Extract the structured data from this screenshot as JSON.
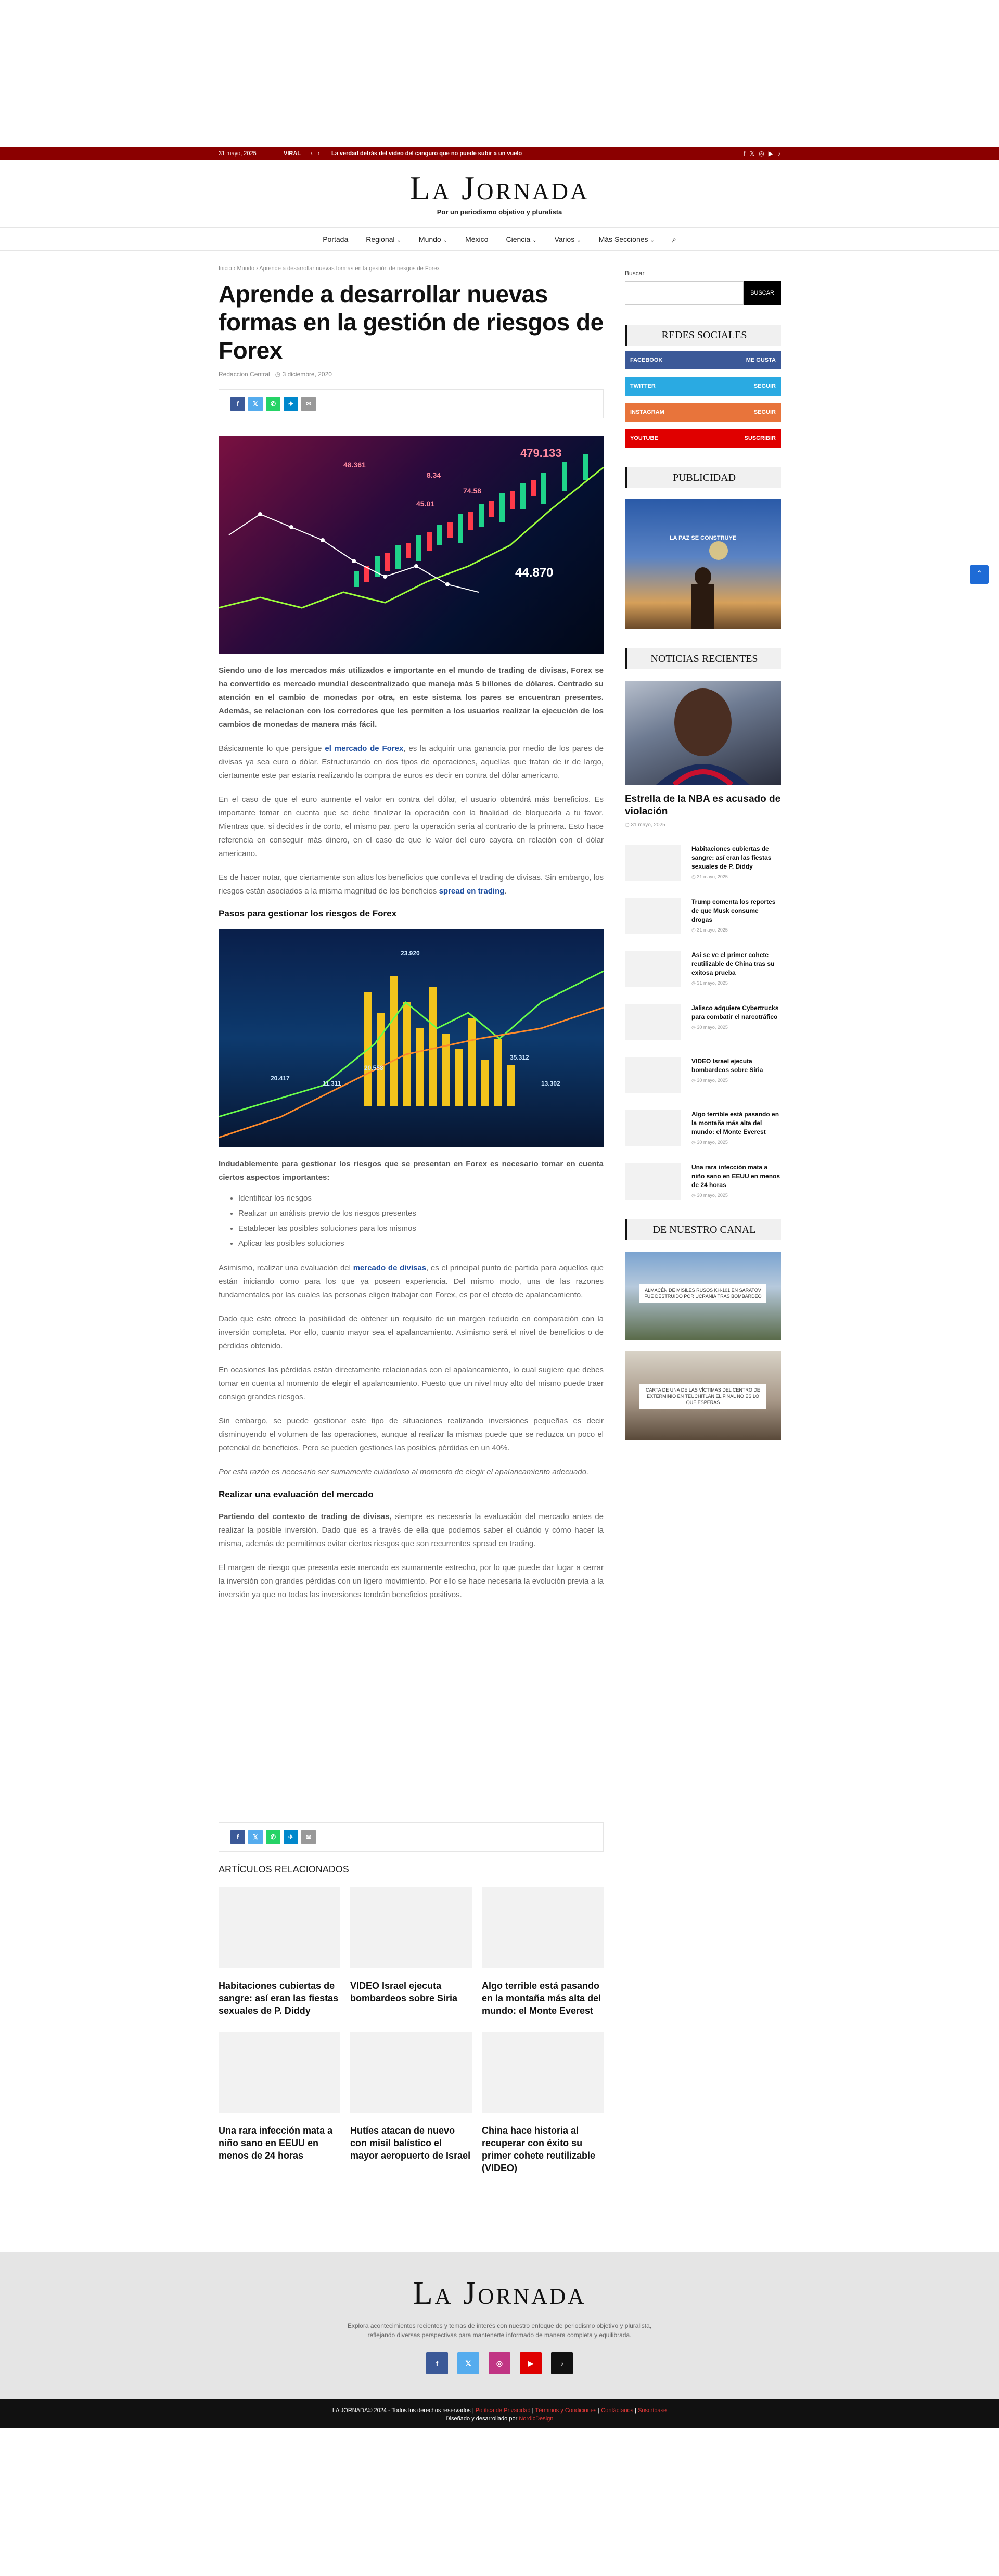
{
  "topbar": {
    "date": "31 mayo, 2025",
    "viral_label": "VIRAL",
    "prev_arrow": "‹",
    "next_arrow": "›",
    "ticker_text": "La verdad detrás del video del canguro que no puede subir a un vuelo",
    "social_icons": [
      "facebook-icon",
      "x-icon",
      "instagram-icon",
      "youtube-icon",
      "tiktok-icon"
    ]
  },
  "header": {
    "logo": "La Jornada",
    "tagline": "Por un periodismo objetivo y pluralista"
  },
  "nav": {
    "items": [
      {
        "label": "Portada",
        "dropdown": false
      },
      {
        "label": "Regional",
        "dropdown": true
      },
      {
        "label": "Mundo",
        "dropdown": true
      },
      {
        "label": "México",
        "dropdown": false
      },
      {
        "label": "Ciencia",
        "dropdown": true
      },
      {
        "label": "Varios",
        "dropdown": true
      },
      {
        "label": "Más Secciones",
        "dropdown": true
      }
    ],
    "search_icon": "search-icon"
  },
  "article": {
    "breadcrumb": [
      "Inicio",
      "Mundo",
      "Aprende a desarrollar nuevas formas en la gestión de riesgos de Forex"
    ],
    "title": "Aprende a desarrollar nuevas formas en la gestión de riesgos de Forex",
    "author": "Redaccion Central",
    "date": "3 diciembre, 2020",
    "share_buttons": [
      "f",
      "𝕏",
      "✆",
      "✈",
      "✉"
    ],
    "intro": "Siendo uno de los mercados más utilizados e importante en el mundo de trading de divisas, Forex se ha convertido es mercado mundial descentralizado que maneja más 5 billones de dólares. Centrado su atención en el cambio de monedas por otra, en este sistema los pares se encuentran presentes. Además, se relacionan con los corredores que les permiten a los usuarios realizar la ejecución de los cambios de monedas de manera más fácil.",
    "p1_before": "Básicamente lo que persigue ",
    "p1_link": "el mercado de Forex",
    "p1_after": ", es la adquirir una ganancia por medio de los pares de divisas ya sea euro o dólar. Estructurando en dos tipos de operaciones, aquellas que tratan de ir de largo, ciertamente este par estaría realizando la compra de euros es decir en contra del dólar americano.",
    "p2": "En el caso de que el euro aumente el valor en contra del dólar, el usuario obtendrá más beneficios. Es importante tomar en cuenta que se debe finalizar la operación con la finalidad de bloquearla a tu favor. Mientras que, si decides ir de corto, el mismo par, pero la operación sería al contrario de la primera. Esto hace referencia en conseguir más dinero, en el caso de que le valor del euro cayera en relación con el dólar americano.",
    "p3_before": "Es de hacer notar, que ciertamente son altos los beneficios que conlleva el trading de divisas. Sin embargo, los riesgos están asociados a la misma magnitud de los beneficios ",
    "p3_link": "spread en trading",
    "p3_after": ".",
    "h_pasos": "Pasos para gestionar los riesgos de Forex",
    "p4": "Indudablemente para gestionar los riesgos que se presentan en Forex es necesario tomar en cuenta ciertos aspectos importantes:",
    "bullets": [
      "Identificar los riesgos",
      "Realizar un análisis previo de los riesgos presentes",
      "Establecer las posibles soluciones para los mismos",
      "Aplicar las posibles soluciones"
    ],
    "p5_before": "Asimismo, realizar una evaluación del ",
    "p5_link": "mercado de divisas",
    "p5_after": ", es el principal punto de partida para aquellos que están iniciando como para los que ya poseen experiencia. Del mismo modo, una de las razones fundamentales por las cuales las personas eligen trabajar con Forex, es por el efecto de apalancamiento.",
    "p6": "Dado que este ofrece la posibilidad de obtener un requisito de un margen reducido en comparación con la inversión completa. Por ello, cuanto mayor sea el apalancamiento. Asimismo será el nivel de beneficios o de pérdidas obtenido.",
    "p7": "En ocasiones las pérdidas están directamente relacionadas con el apalancamiento, lo cual sugiere que debes tomar en cuenta al momento de elegir el apalancamiento. Puesto que un nivel muy alto del mismo puede traer consigo grandes riesgos.",
    "p8": "Sin embargo, se puede gestionar este tipo de situaciones realizando inversiones pequeñas es decir disminuyendo el volumen de las operaciones, aunque al realizar la mismas puede que se reduzca un poco el potencial de beneficios. Pero se pueden gestiones las posibles pérdidas en un 40%.",
    "p9": "Por esta razón es necesario ser sumamente cuidadoso al momento de elegir el apalancamiento adecuado.",
    "h_realizar": "Realizar una evaluación del mercado",
    "p10_bold": "Partiendo del contexto de trading de divisas,",
    "p10_rest": " siempre es necesaria la evaluación del mercado antes de realizar la posible inversión. Dado que es a través de ella que podemos saber el cuándo y cómo hacer la misma, además de permitirnos evitar ciertos riesgos que son recurrentes spread en trading.",
    "p11": "El margen de riesgo que presenta este mercado es sumamente estrecho, por lo que puede dar lugar a cerrar la inversión con grandes pérdidas con un ligero movimiento. Por ello se hace necesaria la evolución previa a la inversión ya que no todas las inversiones tendrán beneficios positivos."
  },
  "hero_chart_labels": [
    "48.361",
    "479.133",
    "44.870",
    "8.34",
    "74.58",
    "45.01"
  ],
  "img2_labels": [
    "23.920",
    "20.558",
    "35.312",
    "13.302",
    "20.417",
    "11.311"
  ],
  "related": {
    "title": "ARTÍCULOS RELACIONADOS",
    "items": [
      "Habitaciones cubiertas de sangre: así eran las fiestas sexuales de P. Diddy",
      "VIDEO Israel ejecuta bombardeos sobre Siria",
      "Algo terrible está pasando en la montaña más alta del mundo: el Monte Everest",
      "Una rara infección mata a niño sano en EEUU en menos de 24 horas",
      "Hutíes atacan de nuevo con misil balístico el mayor aeropuerto de Israel",
      "China hace historia al recuperar con éxito su primer cohete reutilizable (VIDEO)"
    ]
  },
  "sidebar": {
    "search_label": "Buscar",
    "search_button": "BUSCAR",
    "redes_title": "REDES SOCIALES",
    "socials": [
      {
        "name": "FACEBOOK",
        "action": "ME GUSTA",
        "color": "#3b5998",
        "icon": "facebook-icon"
      },
      {
        "name": "TWITTER",
        "action": "SEGUIR",
        "color": "#2aaae2",
        "icon": "twitter-icon"
      },
      {
        "name": "INSTAGRAM",
        "action": "SEGUIR",
        "color": "#e8743b",
        "icon": "instagram-icon"
      },
      {
        "name": "YOUTUBE",
        "action": "SUSCRIBIR",
        "color": "#e00000",
        "icon": "youtube-icon"
      }
    ],
    "publicidad_title": "PUBLICIDAD",
    "ad_text_top": "LA PAZ SE CONSTRUYE",
    "recientes_title": "NOTICIAS RECIENTES",
    "feature_title": "Estrella de la NBA es acusado de violación",
    "feature_date": "31 mayo, 2025",
    "news": [
      {
        "title": "Habitaciones cubiertas de sangre: así eran las fiestas sexuales de P. Diddy",
        "date": "31 mayo, 2025"
      },
      {
        "title": "Trump comenta los reportes de que Musk consume drogas",
        "date": "31 mayo, 2025"
      },
      {
        "title": "Así se ve el primer cohete reutilizable de China tras su exitosa prueba",
        "date": "31 mayo, 2025"
      },
      {
        "title": "Jalisco adquiere Cybertrucks para combatir el narcotráfico",
        "date": "30 mayo, 2025"
      },
      {
        "title": "VIDEO Israel ejecuta bombardeos sobre Siria",
        "date": "30 mayo, 2025"
      },
      {
        "title": "Algo terrible está pasando en la montaña más alta del mundo: el Monte Everest",
        "date": "30 mayo, 2025"
      },
      {
        "title": "Una rara infección mata a niño sano en EEUU en menos de 24 horas",
        "date": "30 mayo, 2025"
      }
    ],
    "canal_title": "DE NUESTRO CANAL",
    "videos": [
      "ALMACÉN DE MISILES RUSOS KH-101 EN SARATOV FUE DESTRUIDO POR UCRANIA TRAS BOMBARDEO",
      "CARTA DE UNA DE LAS VÍCTIMAS DEL CENTRO DE EXTERMINIO EN TEUCHITLÁN EL FINAL NO ES LO QUE ESPERAS"
    ]
  },
  "footer": {
    "logo": "La Jornada",
    "desc_line1": "Explora acontecimientos recientes y temas de interés con nuestro enfoque de periodismo objetivo y pluralista,",
    "desc_line2": "reflejando diversas perspectivas para mantenerte informado de manera completa y equilibrada.",
    "icons": [
      {
        "icon": "facebook-icon",
        "glyph": "f",
        "color": "#3b5998"
      },
      {
        "icon": "x-icon",
        "glyph": "𝕏",
        "color": "#55acee"
      },
      {
        "icon": "instagram-icon",
        "glyph": "◎",
        "color": "#c13584"
      },
      {
        "icon": "youtube-icon",
        "glyph": "▶",
        "color": "#e00000"
      },
      {
        "icon": "tiktok-icon",
        "glyph": "♪",
        "color": "#111111"
      }
    ],
    "copyright": "LA JORNADA© 2024 - Todos los derechos reservados",
    "links": [
      "Política de Privacidad",
      "Términos y Condiciones",
      "Contáctanos",
      "Suscríbase"
    ],
    "credit_prefix": "Diseñado y desarrollado por",
    "credit_name": "NordicDesign"
  },
  "scroll_top": "⌃"
}
